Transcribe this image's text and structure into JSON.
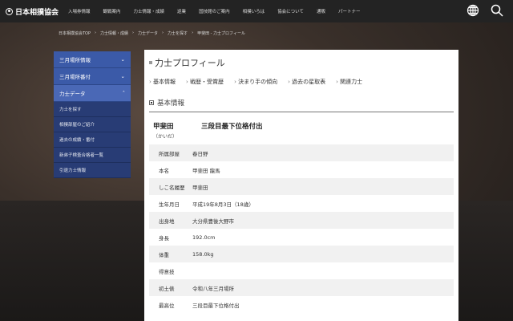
{
  "header": {
    "logo": "日本相撲協会",
    "nav": [
      "入場券情報",
      "観戦案内",
      "力士情報・成績",
      "巡業",
      "国技館のご案内",
      "相撲いろは",
      "協会について",
      "通販",
      "パートナー"
    ]
  },
  "breadcrumb": [
    "日本相撲協会TOP",
    "力士情報・成績",
    "力士データ",
    "力士を探す",
    "甲斐田 - 力士プロフィール"
  ],
  "sidebar": {
    "top": [
      "三月場所情報",
      "三月場所番付",
      "力士データ"
    ],
    "sub": [
      "力士を探す",
      "相撲部屋のご紹介",
      "過去の成績・番付",
      "新弟子検査合格者一覧",
      "引退力士情報"
    ]
  },
  "main": {
    "title": "力士プロフィール",
    "tabs": [
      "基本情報",
      "戦歴・受賞歴",
      "決まり手の傾向",
      "過去の星取表",
      "関連力士"
    ],
    "section": "基本情報",
    "name": "甲斐田",
    "kana": "（かいだ）",
    "rank": "三段目最下位格付出",
    "rows": [
      {
        "k": "所属部屋",
        "v": "春日野"
      },
      {
        "k": "本名",
        "v": "甲斐田 龍馬"
      },
      {
        "k": "しこ名履歴",
        "v": "甲斐田"
      },
      {
        "k": "生年月日",
        "v": "平成19年8月3日（18歳）"
      },
      {
        "k": "出身地",
        "v": "大分県豊後大野市"
      },
      {
        "k": "身長",
        "v": "192.0cm"
      },
      {
        "k": "体重",
        "v": "158.0kg"
      },
      {
        "k": "得意技",
        "v": ""
      },
      {
        "k": "初土俵",
        "v": "令和八年三月場所"
      },
      {
        "k": "最高位",
        "v": "三段目最下位格付出"
      }
    ]
  }
}
